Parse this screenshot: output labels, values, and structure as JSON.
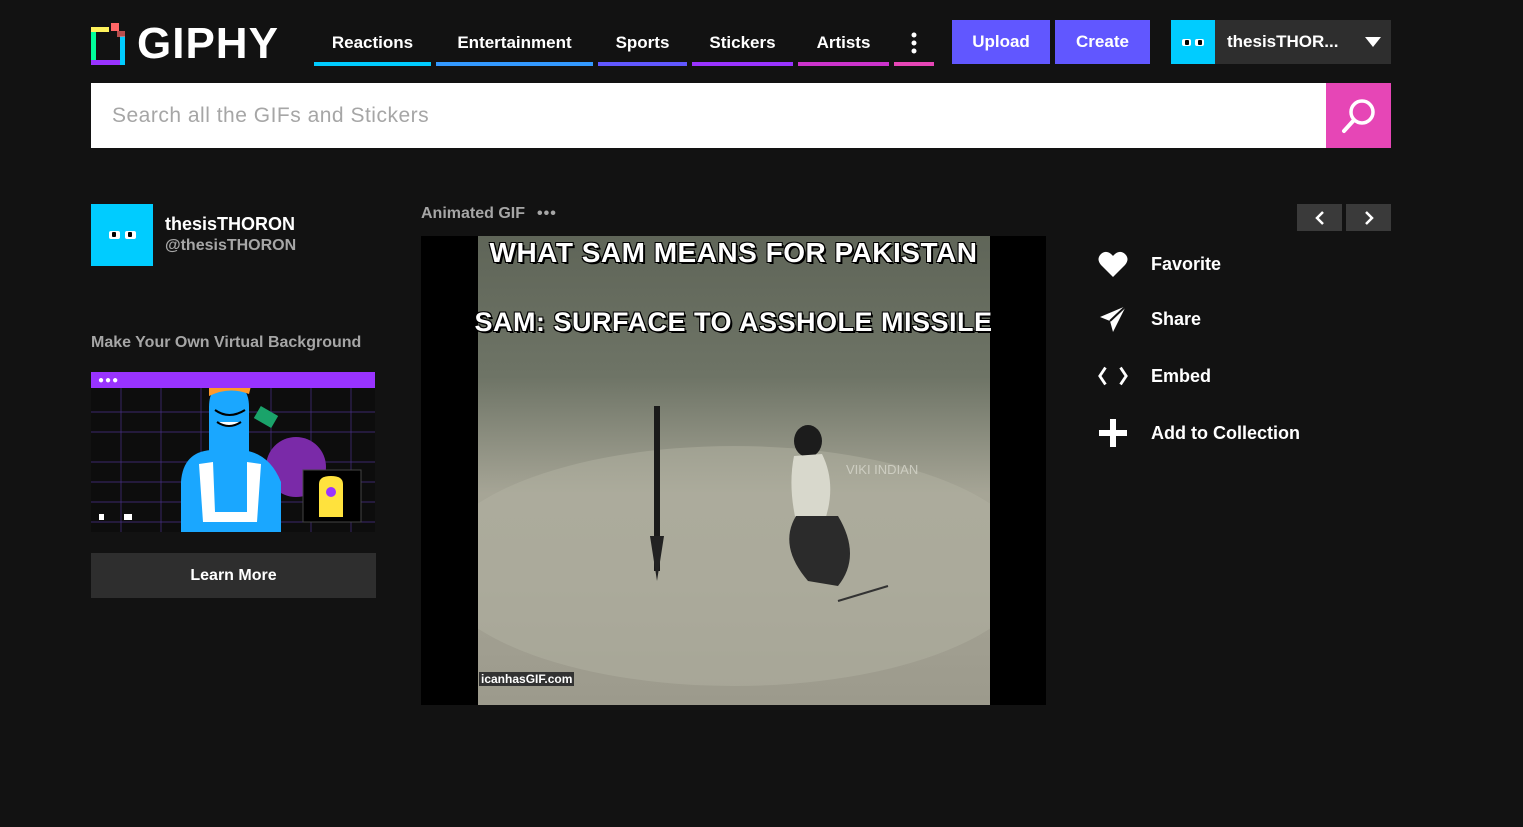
{
  "brand": {
    "name": "GIPHY"
  },
  "nav": {
    "items": [
      {
        "label": "Reactions",
        "color": "#00ccff"
      },
      {
        "label": "Entertainment",
        "color": "#3399ff"
      },
      {
        "label": "Sports",
        "color": "#6157ff"
      },
      {
        "label": "Stickers",
        "color": "#9933ff"
      },
      {
        "label": "Artists",
        "color": "#cc33cc"
      }
    ],
    "more_color": "#e646b6",
    "upload_label": "Upload",
    "create_label": "Create"
  },
  "user": {
    "name": "thesisTHOR..."
  },
  "search": {
    "placeholder": "Search all the GIFs and Stickers"
  },
  "channel": {
    "name": "thesisTHORON",
    "handle": "@thesisTHORON"
  },
  "promo": {
    "title": "Make Your Own Virtual Background",
    "cta": "Learn More"
  },
  "gif": {
    "label": "Animated GIF",
    "caption_top": "WHAT SAM MEANS FOR PAKISTAN",
    "caption_bottom": "SAM:  SURFACE TO ASSHOLE MISSILE",
    "watermark_1": "VIKI INDIAN",
    "watermark_2": "icanhasGIF.com"
  },
  "actions": {
    "favorite": "Favorite",
    "share": "Share",
    "embed": "Embed",
    "collection": "Add to Collection"
  },
  "colors": {
    "background": "#121212",
    "accent": "#6157ff",
    "search_button": "#e646b6",
    "avatar": "#00ccff"
  }
}
